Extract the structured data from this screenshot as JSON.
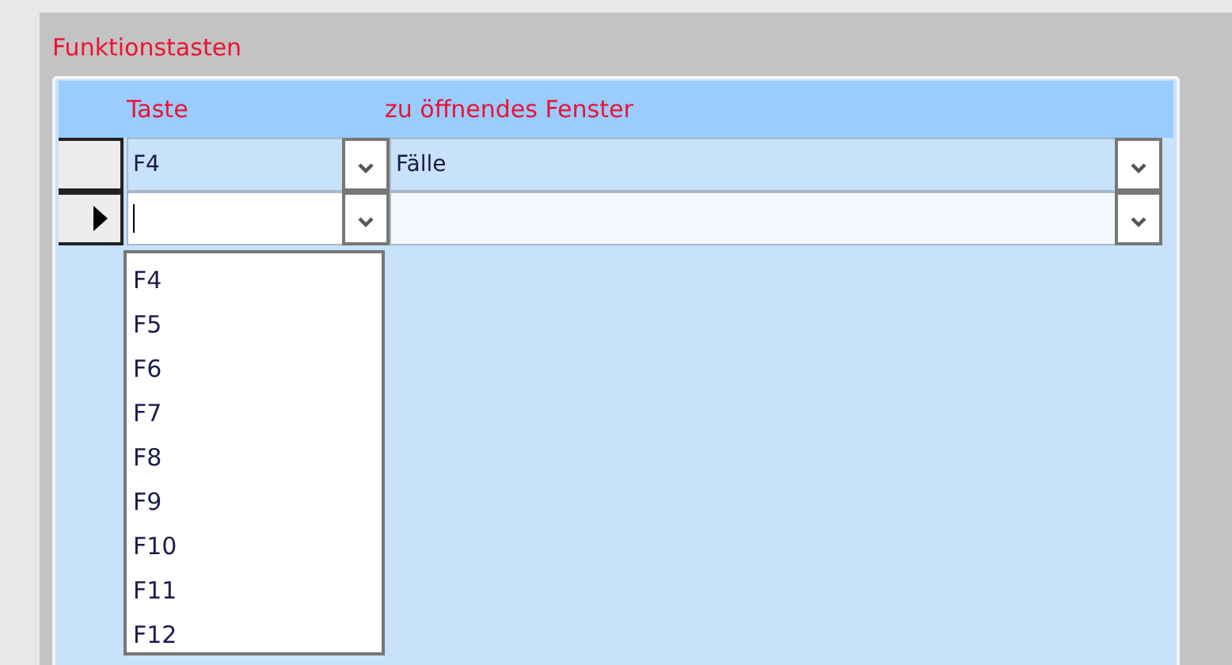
{
  "section": {
    "title": "Funktionstasten"
  },
  "columns": [
    {
      "label": "Taste"
    },
    {
      "label": "zu öffnendes Fenster"
    }
  ],
  "rows": [
    {
      "selected": false,
      "key": "F4",
      "window": "Fälle"
    },
    {
      "selected": true,
      "editing": true
    }
  ],
  "dropdown": {
    "open": true,
    "options": [
      "F4",
      "F5",
      "F6",
      "F7",
      "F8",
      "F9",
      "F10",
      "F11",
      "F12"
    ]
  }
}
